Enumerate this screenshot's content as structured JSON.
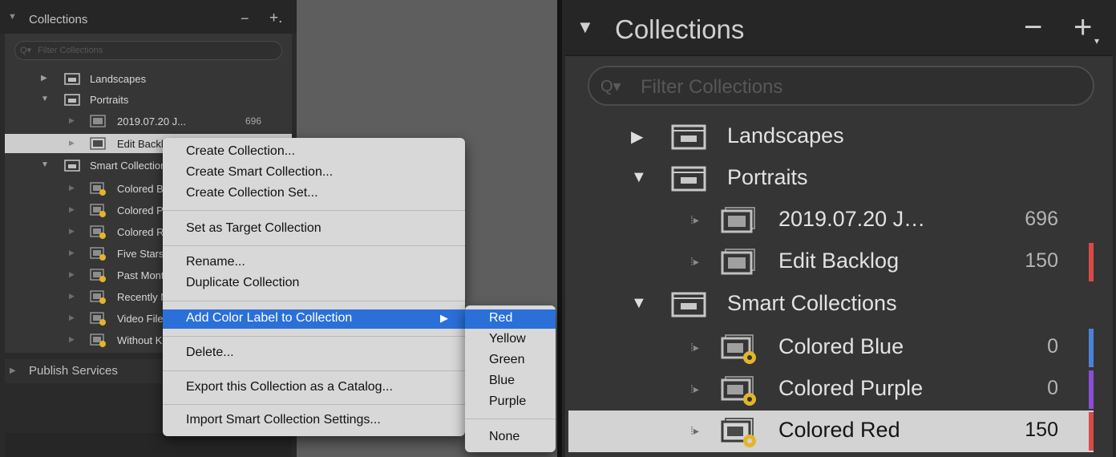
{
  "left_panel": {
    "header": {
      "title": "Collections",
      "minus": "−",
      "plus": "+."
    },
    "search_placeholder": "Filter Collections",
    "rows": [
      {
        "name": "Landscapes",
        "count": ""
      },
      {
        "name": "Portraits",
        "count": ""
      },
      {
        "name": "2019.07.20 J...",
        "count": "696"
      },
      {
        "name": "Edit Backlog",
        "count": ""
      },
      {
        "name": "Smart Collections",
        "count": ""
      },
      {
        "name": "Colored Blue",
        "count": ""
      },
      {
        "name": "Colored Purple",
        "count": ""
      },
      {
        "name": "Colored Red",
        "count": ""
      },
      {
        "name": "Five Stars",
        "count": ""
      },
      {
        "name": "Past Month",
        "count": ""
      },
      {
        "name": "Recently Modified",
        "count": ""
      },
      {
        "name": "Video Files",
        "count": ""
      },
      {
        "name": "Without Keywords",
        "count": ""
      }
    ],
    "publish_title": "Publish Services"
  },
  "context_menu": {
    "items": [
      "Create Collection...",
      "Create Smart Collection...",
      "Create Collection Set...",
      "Set as Target Collection",
      "Rename...",
      "Duplicate Collection",
      "Add Color Label to Collection",
      "Delete...",
      "Export this Collection as a Catalog...",
      "Import Smart Collection Settings..."
    ],
    "submenu_arrow": "▶"
  },
  "color_submenu": {
    "items": [
      "Red",
      "Yellow",
      "Green",
      "Blue",
      "Purple",
      "None"
    ]
  },
  "right_panel": {
    "header": {
      "title": "Collections",
      "minus": "−",
      "plus": "+"
    },
    "search_placeholder": "Filter Collections",
    "rows": [
      {
        "name": "Landscapes",
        "count": ""
      },
      {
        "name": "Portraits",
        "count": ""
      },
      {
        "name": "2019.07.20 J…",
        "count": "696"
      },
      {
        "name": "Edit Backlog",
        "count": "150"
      },
      {
        "name": "Smart Collections",
        "count": ""
      },
      {
        "name": "Colored Blue",
        "count": "0"
      },
      {
        "name": "Colored Purple",
        "count": "0"
      },
      {
        "name": "Colored Red",
        "count": "150"
      }
    ]
  },
  "colors": {
    "label_red": "#d94a48",
    "label_blue": "#4a82d8",
    "label_purple": "#8a4ed6",
    "menu_highlight": "#2a70d8"
  },
  "icons": {
    "collapsed": "▶",
    "expanded": "▼",
    "set": "collection-set-icon",
    "collection": "collection-icon",
    "smart": "smart-collection-icon",
    "search": "search-icon"
  }
}
